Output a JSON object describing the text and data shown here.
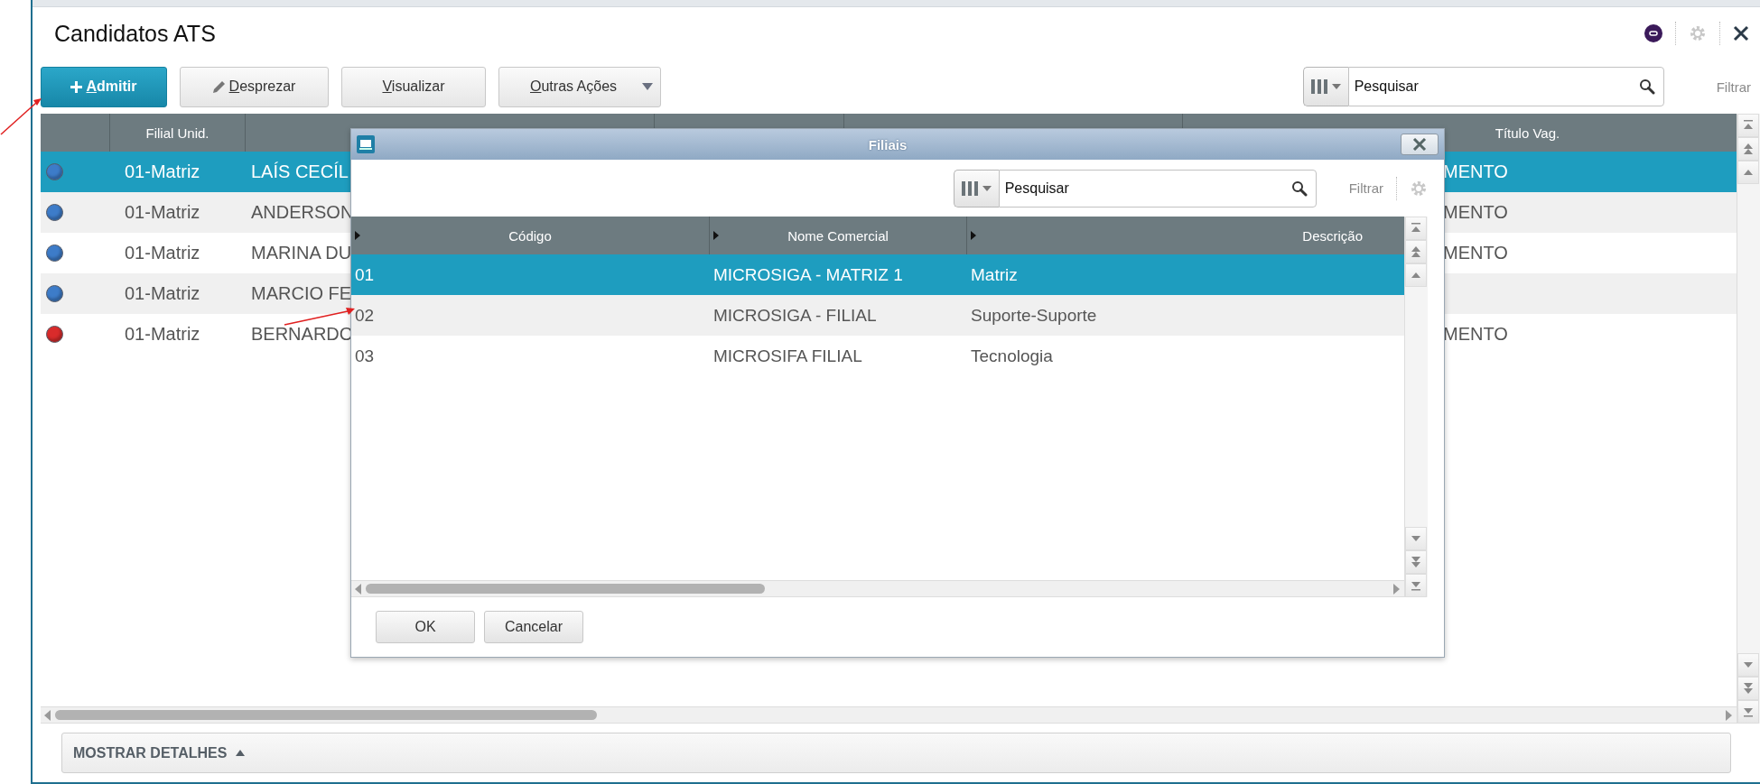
{
  "window": {
    "title": "Candidatos ATS"
  },
  "toolbar": {
    "buttons": [
      {
        "kind": "add",
        "label": "Admitir"
      },
      {
        "kind": "edit",
        "label": "Desprezar"
      },
      {
        "kind": "plain",
        "label": "Visualizar"
      },
      {
        "kind": "menu",
        "label": "Outras Ações"
      }
    ],
    "search": {
      "placeholder": "Pesquisar"
    },
    "filter_label": "Filtrar"
  },
  "grid": {
    "header": {
      "branch": "Filial Unid.",
      "job_title": "Título Vag."
    },
    "rows": [
      {
        "color": "#3d7cc9",
        "branch": "01-Matriz",
        "name": "LAÍS CECÍL",
        "job_title": "MENTO",
        "selected": true
      },
      {
        "color": "#3d7cc9",
        "branch": "01-Matriz",
        "name": "ANDERSON",
        "job_title": "MENTO",
        "selected": false
      },
      {
        "color": "#3d7cc9",
        "branch": "01-Matriz",
        "name": "MARINA DU",
        "job_title": "MENTO",
        "selected": false
      },
      {
        "color": "#3d7cc9",
        "branch": "01-Matriz",
        "name": "MARCIO FE",
        "selected": false
      },
      {
        "color": "#d92b2b",
        "branch": "01-Matriz",
        "name": "BERNARDO",
        "job_title": "MENTO",
        "selected": false
      }
    ]
  },
  "dialog": {
    "title": "Filiais",
    "search": {
      "placeholder": "Pesquisar"
    },
    "filter_label": "Filtrar",
    "columns": [
      "Código",
      "Nome Comercial",
      "Descrição"
    ],
    "rows": [
      {
        "selected": true,
        "cells": [
          "01",
          "MICROSIGA - MATRIZ 1",
          "Matriz"
        ]
      },
      {
        "selected": false,
        "cells": [
          "02",
          "MICROSIGA - FILIAL",
          "Suporte-Suporte"
        ]
      },
      {
        "selected": false,
        "cells": [
          "03",
          "MICROSIFA FILIAL",
          "Tecnologia"
        ]
      }
    ],
    "buttons": [
      "OK",
      "Cancelar"
    ]
  },
  "details": {
    "label": "MOSTRAR DETALHES"
  }
}
